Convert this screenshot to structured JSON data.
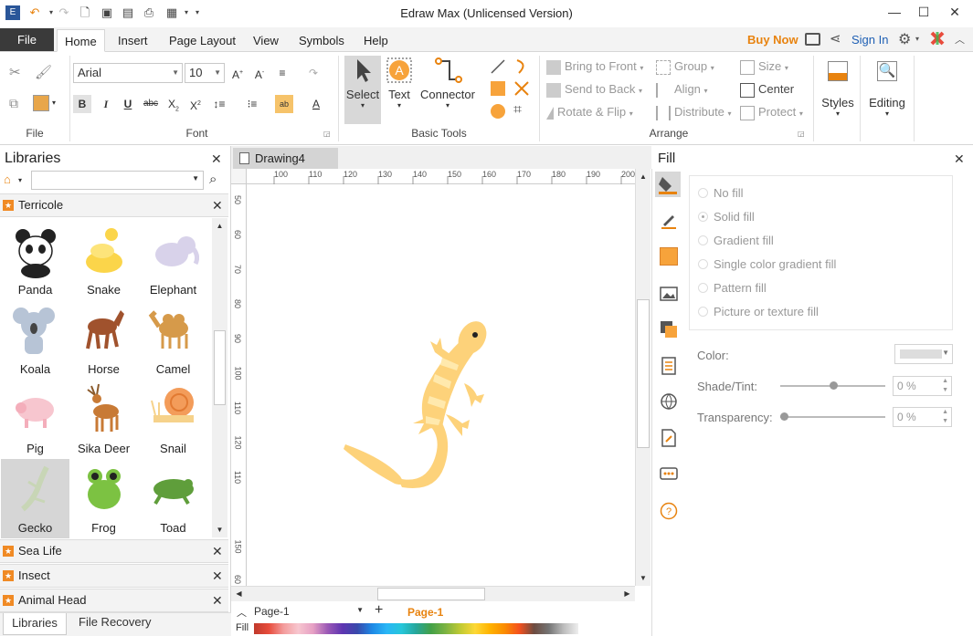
{
  "window": {
    "title": "Edraw Max (Unlicensed Version)"
  },
  "tabs": [
    "Home",
    "Insert",
    "Page Layout",
    "View",
    "Symbols",
    "Help"
  ],
  "file_tab": "File",
  "header_right": {
    "buy_now": "Buy Now",
    "sign_in": "Sign In"
  },
  "ribbon": {
    "groups": {
      "file": "File",
      "font": "Font",
      "basic_tools": "Basic Tools",
      "arrange": "Arrange"
    },
    "font_name": "Arial",
    "font_size": "10",
    "basic_tools": {
      "select": "Select",
      "text": "Text",
      "connector": "Connector"
    },
    "arrange": {
      "bring_to_front": "Bring to Front",
      "send_to_back": "Send to Back",
      "rotate_flip": "Rotate & Flip",
      "group": "Group",
      "align": "Align",
      "distribute": "Distribute",
      "size": "Size",
      "center": "Center",
      "protect": "Protect"
    },
    "styles": "Styles",
    "editing": "Editing"
  },
  "libraries": {
    "title": "Libraries",
    "open_library": "Terricole",
    "shapes": [
      "Panda",
      "Snake",
      "Elephant",
      "Koala",
      "Horse",
      "Camel",
      "Pig",
      "Sika Deer",
      "Snail",
      "Gecko",
      "Frog",
      "Toad"
    ],
    "selected_shape": "Gecko",
    "collapsed": [
      "Sea Life",
      "Insect",
      "Animal Head"
    ],
    "bottom_tabs": [
      "Libraries",
      "File Recovery"
    ]
  },
  "document": {
    "tab": "Drawing4",
    "ruler_top": [
      "100",
      "110",
      "120",
      "130",
      "140",
      "150",
      "160",
      "170",
      "180",
      "190",
      "200"
    ],
    "ruler_left": [
      "50",
      "60",
      "70",
      "80",
      "90",
      "100",
      "110",
      "120",
      "110",
      "150",
      "60"
    ],
    "page_select": "Page-1",
    "page_tab": "Page-1",
    "fill_label": "Fill"
  },
  "fill_panel": {
    "title": "Fill",
    "options": [
      "No fill",
      "Solid fill",
      "Gradient fill",
      "Single color gradient fill",
      "Pattern fill",
      "Picture or texture fill"
    ],
    "selected": "Solid fill",
    "color_label": "Color:",
    "shade_label": "Shade/Tint:",
    "shade_value": "0 %",
    "transparency_label": "Transparency:",
    "transparency_value": "0 %"
  },
  "colors": {
    "accent": "#f08a24",
    "gecko": "#fdd27a",
    "gecko_stripe": "#ffe9ad"
  }
}
